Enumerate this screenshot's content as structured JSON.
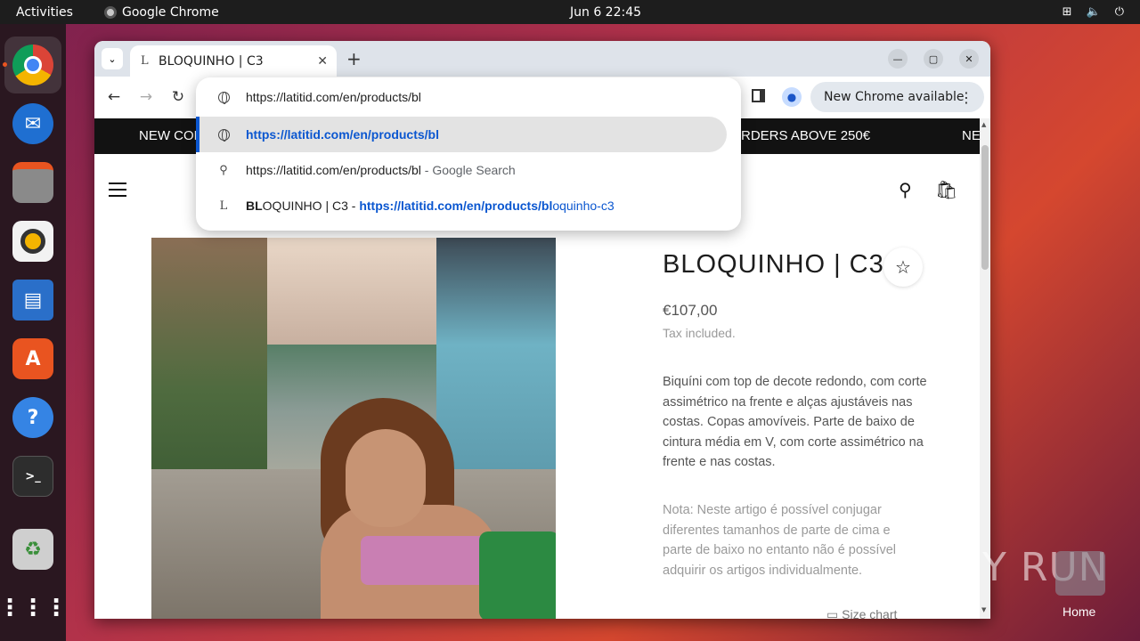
{
  "topbar": {
    "activities": "Activities",
    "app_name": "Google Chrome",
    "clock": "Jun 6  22:45",
    "tray_icons": [
      "network-icon",
      "volume-icon",
      "power-icon"
    ]
  },
  "dock": {
    "items": [
      "chrome",
      "thunderbird",
      "files",
      "rhythmbox",
      "libreoffice-writer",
      "app-center",
      "help",
      "terminal",
      "trash",
      "show-apps"
    ]
  },
  "browser": {
    "tab_title": "BLOQUINHO | C3",
    "tab_favicon": "L",
    "new_tab": "+",
    "update_button": "New Chrome available",
    "address_text": "https://latitid.com/en/products/bl"
  },
  "omnibox": {
    "rows": [
      {
        "text": "https://latitid.com/en/products/bl"
      },
      {
        "text": "https://latitid.com/en/products/bl"
      },
      {
        "query": "https://latitid.com/en/products/bl",
        "suffix": " - Google Search"
      },
      {
        "title_bold": "BL",
        "title_rest": "OQUINHO | C3",
        "sep": " - ",
        "url_bold": "https://latitid.com/en/products/bl",
        "url_rest": "oquinho-c3"
      }
    ]
  },
  "page": {
    "announce_left": "NEW COL",
    "announce_mid": "RDERS ABOVE 250€",
    "announce_right": "NE",
    "product": {
      "title": "BLOQUINHO | C3",
      "price": "€107,00",
      "tax": "Tax included.",
      "description": "Biquíni com top de decote redondo, com corte assimétrico na frente e alças ajustáveis nas costas. Copas amovíveis. Parte de baixo de cintura média em V, com corte assimétrico na frente e nas costas.",
      "note": "Nota: Neste artigo é possível conjugar diferentes tamanhos de parte de cima e parte de baixo no entanto não é possível adquirir os artigos individualmente.",
      "size_chart": "Size chart"
    }
  },
  "desktop": {
    "watermark": "ANY RUN",
    "home_label": "Home"
  },
  "colors": {
    "accent": "#0b57d0",
    "ubuntu_orange": "#e95420",
    "announce_bg": "#121212"
  }
}
